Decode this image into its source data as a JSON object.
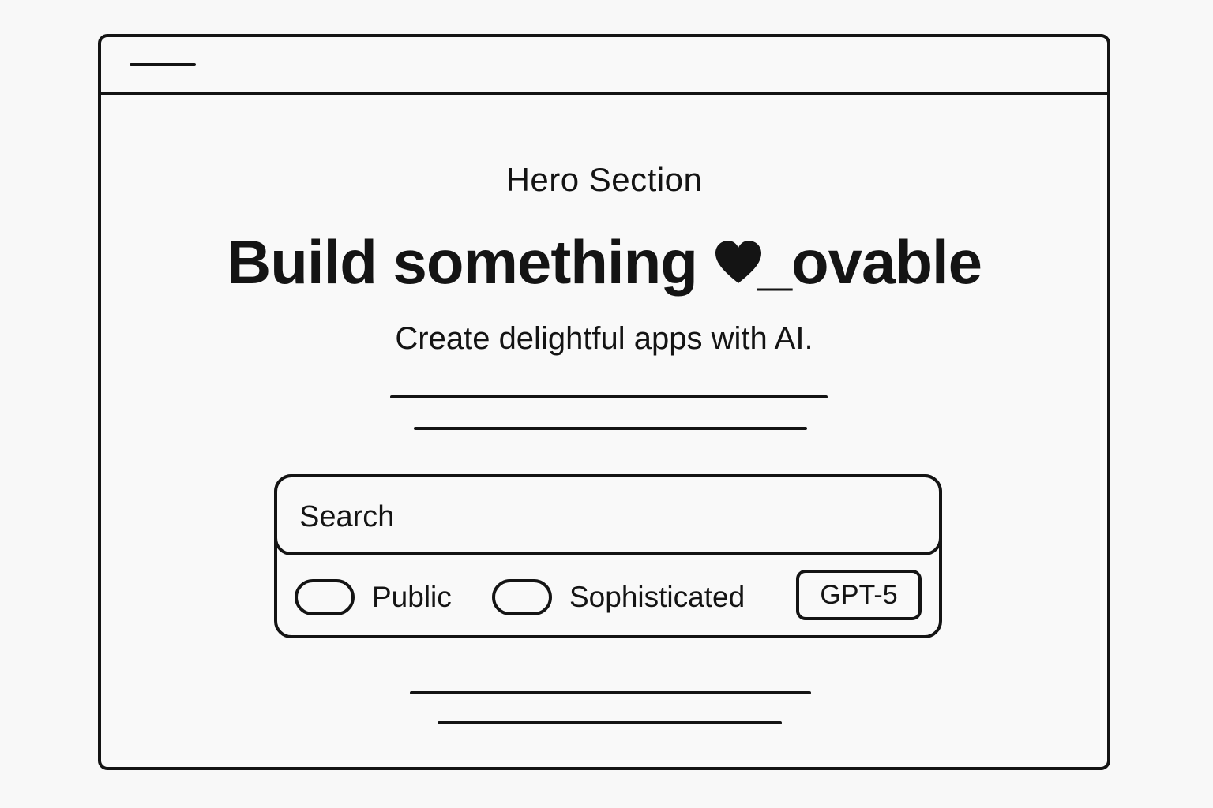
{
  "hero": {
    "eyebrow": "Hero Section",
    "headline_before": "Build something ",
    "headline_after": "_ovable",
    "subtitle": "Create delightful apps with AI."
  },
  "prompt_box": {
    "search_placeholder": "Search",
    "toggles": [
      {
        "label": "Public",
        "on": false
      },
      {
        "label": "Sophisticated",
        "on": false
      }
    ],
    "model_button": "GPT-5"
  },
  "icons": {
    "menu": "menu-line-icon",
    "heart": "heart-icon"
  },
  "colors": {
    "ink": "#141414",
    "background": "#f8f8f8"
  }
}
